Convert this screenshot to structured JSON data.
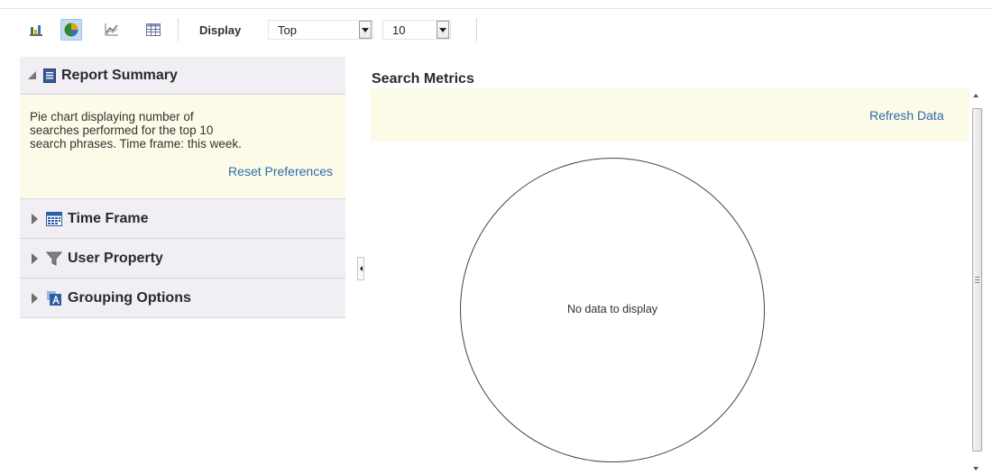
{
  "toolbar": {
    "buttons": [
      {
        "icon": "bar-chart-icon",
        "active": false
      },
      {
        "icon": "pie-chart-icon",
        "active": true
      },
      {
        "icon": "line-chart-icon",
        "active": false
      },
      {
        "icon": "table-icon",
        "active": false
      }
    ],
    "display_label": "Display",
    "display_select": {
      "value": "Top"
    },
    "count_select": {
      "value": "10"
    }
  },
  "left_panel": {
    "summary": {
      "title": "Report Summary",
      "icon": "report-icon",
      "expanded": true,
      "text": "Pie chart displaying number of searches performed for the top 10 search phrases. Time frame: this week.",
      "reset_link": "Reset Preferences"
    },
    "sections": [
      {
        "title": "Time Frame",
        "icon": "calendar-icon",
        "expanded": false
      },
      {
        "title": "User Property",
        "icon": "filter-icon",
        "expanded": false
      },
      {
        "title": "Grouping Options",
        "icon": "grouping-icon",
        "expanded": false
      }
    ]
  },
  "main": {
    "title": "Search Metrics",
    "refresh_link": "Refresh Data",
    "empty_message": "No data to display"
  },
  "colors": {
    "link": "#2c6aab",
    "header_bg": "#f1eef4",
    "info_bg": "#fcfbe8",
    "active_button": "#c4dbf3"
  }
}
